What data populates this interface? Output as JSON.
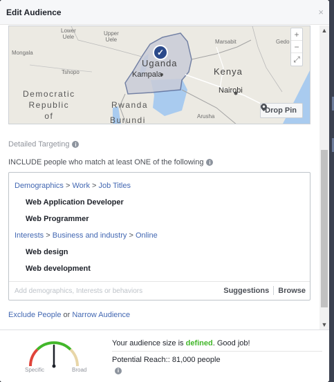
{
  "dialog": {
    "title": "Edit Audience",
    "close_glyph": "×"
  },
  "map": {
    "labels": {
      "lower_uele": "Lower\nUele",
      "upper_uele": "Upper\nUele",
      "marsabit": "Marsabit",
      "gedo": "Gedo",
      "mongala": "Mongala",
      "tshopo": "Tshopo",
      "uganda": "Uganda",
      "kampala": "Kampala",
      "kenya": "Kenya",
      "nairobi": "Nairobi",
      "drc": "Democratic\nRepublic\nof",
      "rwanda": "Rwanda",
      "burundi": "Burundi",
      "arusha": "Arusha"
    },
    "zoom_in": "+",
    "zoom_out": "−",
    "fullscreen": "⤢",
    "drop_pin_label": "Drop Pin",
    "pin_check": "✓"
  },
  "detailed_targeting": {
    "label": "Detailed Targeting",
    "include_label": "INCLUDE people who match at least ONE of the following",
    "groups": [
      {
        "path": [
          "Demographics",
          "Work",
          "Job Titles"
        ],
        "items": [
          "Web Application Developer",
          "Web Programmer"
        ]
      },
      {
        "path": [
          "Interests",
          "Business and industry",
          "Online"
        ],
        "items": [
          "Web design",
          "Web development"
        ]
      }
    ],
    "separator": ">",
    "input_placeholder": "Add demographics, Interests or behaviors",
    "suggestions_label": "Suggestions",
    "browse_label": "Browse"
  },
  "exclude": {
    "exclude_label": "Exclude People",
    "or_text": "or",
    "narrow_label": "Narrow Audience"
  },
  "audience": {
    "size_prefix": "Your audience size is",
    "size_state": "defined",
    "size_suffix": ". Good job!",
    "reach_label": "Potential Reach::",
    "reach_value": "81,000 people",
    "gauge_left": "Specific",
    "gauge_right": "Broad",
    "gauge_level": 0.5
  },
  "colors": {
    "link": "#4267b2",
    "defined_green": "#42b72a",
    "gauge_red": "#e0443a",
    "gauge_green": "#42b72a",
    "gauge_tan": "#e8d6a8"
  }
}
